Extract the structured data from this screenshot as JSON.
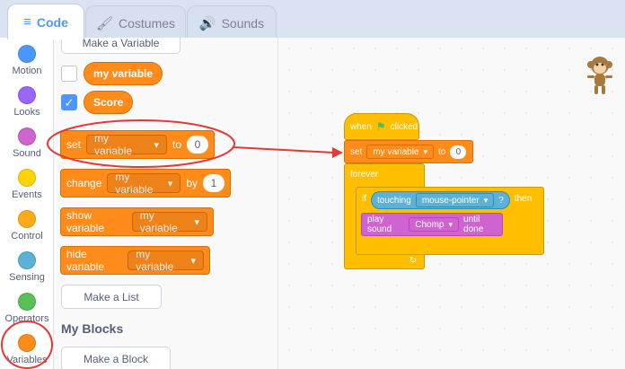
{
  "tabs": {
    "code": "Code",
    "costumes": "Costumes",
    "sounds": "Sounds"
  },
  "categories": [
    {
      "label": "Motion",
      "color": "#4c97ff"
    },
    {
      "label": "Looks",
      "color": "#9966ff"
    },
    {
      "label": "Sound",
      "color": "#cf63cf"
    },
    {
      "label": "Events",
      "color": "#ffd500"
    },
    {
      "label": "Control",
      "color": "#ffab19"
    },
    {
      "label": "Sensing",
      "color": "#5cb1d6"
    },
    {
      "label": "Operators",
      "color": "#59c059"
    },
    {
      "label": "Variables",
      "color": "#ff8c1a"
    }
  ],
  "palette": {
    "make_variable": "Make a Variable",
    "var_my_variable": "my variable",
    "var_score": "Score",
    "set_block": {
      "label": "set",
      "var": "my variable",
      "to": "to",
      "value": "0"
    },
    "change_block": {
      "label": "change",
      "var": "my variable",
      "by": "by",
      "value": "1"
    },
    "show_block": {
      "label": "show variable",
      "var": "my variable"
    },
    "hide_block": {
      "label": "hide variable",
      "var": "my variable"
    },
    "make_list": "Make a List",
    "my_blocks_title": "My Blocks",
    "make_block": "Make a Block"
  },
  "script": {
    "hat": {
      "when": "when",
      "clicked": "clicked"
    },
    "set": {
      "label": "set",
      "var": "my variable",
      "to": "to",
      "value": "0"
    },
    "forever": "forever",
    "if": "if",
    "touching": {
      "label": "touching",
      "target": "mouse-pointer",
      "q": "?"
    },
    "then": "then",
    "play_sound": {
      "label": "play sound",
      "sound": "Chomp",
      "until": "until done"
    }
  },
  "colors": {
    "highlight": "#e53935",
    "accent": "#4c97ff"
  }
}
